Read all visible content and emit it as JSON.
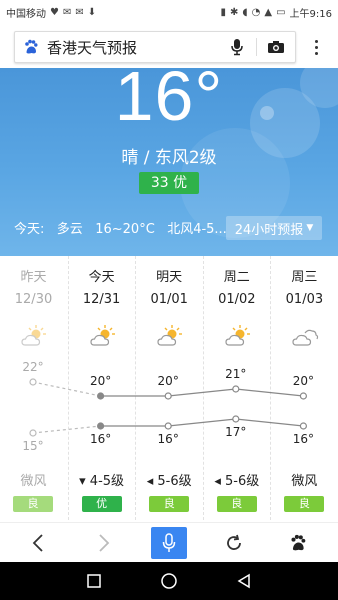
{
  "status_bar": {
    "carrier": "中国移动",
    "time": "上午9:16",
    "battery_icon": "battery-icon",
    "wifi_icon": "wifi-icon"
  },
  "search": {
    "query": "香港天气预报",
    "logo_icon": "paw-icon",
    "mic_icon": "microphone-icon",
    "camera_icon": "camera-icon",
    "more_icon": "more-vertical-icon"
  },
  "current": {
    "temperature": "16°",
    "condition": "晴 / 东风2级",
    "aqi_label": "33 优",
    "aqi_color": "#2fb24b"
  },
  "today": {
    "label": "今天:",
    "weather": "多云",
    "range": "16~20°C",
    "wind": "北风4-5..."
  },
  "forecast_button": {
    "label": "24小时预报",
    "icon": "caret-down-icon"
  },
  "forecast": [
    {
      "day": "昨天",
      "date": "12/30",
      "icon": "sun-cloud-icon",
      "high": "22°",
      "low": "15°",
      "wind": "微风",
      "aqi": "良",
      "aqi_color": "#a5db7c",
      "muted": true
    },
    {
      "day": "今天",
      "date": "12/31",
      "icon": "sun-cloud-icon",
      "high": "20°",
      "low": "16°",
      "wind": "▾ 4-5级",
      "aqi": "优",
      "aqi_color": "#2fb24b",
      "muted": false
    },
    {
      "day": "明天",
      "date": "01/01",
      "icon": "sun-cloud-icon",
      "high": "20°",
      "low": "16°",
      "wind": "◂ 5-6级",
      "aqi": "良",
      "aqi_color": "#7ccb3a",
      "muted": false
    },
    {
      "day": "周二",
      "date": "01/02",
      "icon": "sun-cloud-icon",
      "high": "21°",
      "low": "17°",
      "wind": "◂ 5-6级",
      "aqi": "良",
      "aqi_color": "#7ccb3a",
      "muted": false
    },
    {
      "day": "周三",
      "date": "01/03",
      "icon": "cloud-icon",
      "high": "20°",
      "low": "16°",
      "wind": "微风",
      "aqi": "良",
      "aqi_color": "#7ccb3a",
      "muted": false
    }
  ],
  "browser_bar": {
    "back_icon": "back-arrow-icon",
    "forward_icon": "forward-arrow-icon",
    "voice_icon": "microphone-icon",
    "refresh_icon": "refresh-icon",
    "home_icon": "paw-icon",
    "accent": "#3a86f1"
  },
  "nav_bar": {
    "recent_icon": "square-icon",
    "home_icon": "circle-icon",
    "back_icon": "triangle-back-icon"
  }
}
